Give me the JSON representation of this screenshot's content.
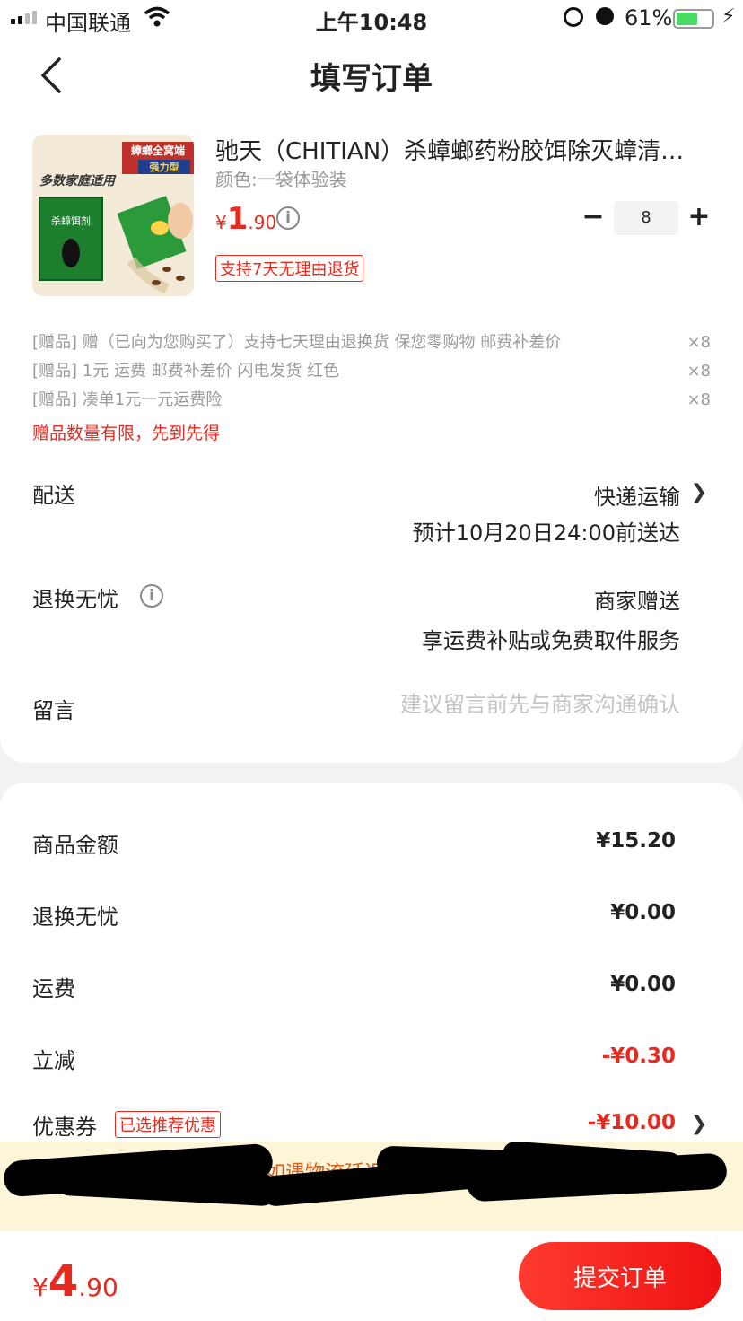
{
  "status_bar": {
    "carrier": "中国联通",
    "time": "上午10:48",
    "battery_percent": "61%",
    "battery_level": 0.61
  },
  "nav": {
    "back_icon": "chevron-left-icon",
    "title": "填写订单"
  },
  "product": {
    "title": "驰天（CHITIAN）杀蟑螂药粉胶饵除灭蟑清…",
    "variant": "颜色:一袋体验装",
    "price_currency": "¥",
    "price_integer": "1",
    "price_decimal": ".90",
    "quantity": "8",
    "return_badge": "支持7天无理由退货",
    "image_banner": "蟑螂全窝端",
    "image_banner_sub": "强力型",
    "image_slogan": "多数家庭适用",
    "image_pack_label": "杀蟑饵剂"
  },
  "gifts": [
    {
      "text": "[赠品] 赠（已向为您购买了）支持七天理由退换货 保您零购物 邮费补差价",
      "qty": "×8"
    },
    {
      "text": "[赠品] 1元 运费 邮费补差价 闪电发货 红色",
      "qty": "×8"
    },
    {
      "text": "[赠品] 凑单1元一元运费险",
      "qty": "×8"
    }
  ],
  "gift_warning": "赠品数量有限，先到先得",
  "delivery": {
    "label": "配送",
    "method": "快递运输",
    "estimate": "预计10月20日24:00前送达"
  },
  "return_service": {
    "label": "退换无忧",
    "value": "商家赠送",
    "detail": "享运费补贴或免费取件服务"
  },
  "memo": {
    "label": "留言",
    "placeholder": "建议留言前先与商家沟通确认"
  },
  "summary": {
    "goods_label": "商品金额",
    "goods_value": "¥15.20",
    "return_label": "退换无忧",
    "return_value": "¥0.00",
    "shipping_label": "运费",
    "shipping_value": "¥0.00",
    "discount_label": "立减",
    "discount_value": "-¥0.30",
    "coupon_label": "优惠券",
    "coupon_badge": "已选推荐优惠",
    "coupon_value": "-¥10.00"
  },
  "notice": {
    "text": "请务必核对收货地址信息，如遇物流延迟请联系商家询问"
  },
  "footer": {
    "total_currency": "¥",
    "total_integer": "4",
    "total_decimal": ".90",
    "submit_label": "提交订单"
  },
  "colors": {
    "accent_red": "#e52b1f",
    "notice_bg": "#fdf5d8"
  }
}
